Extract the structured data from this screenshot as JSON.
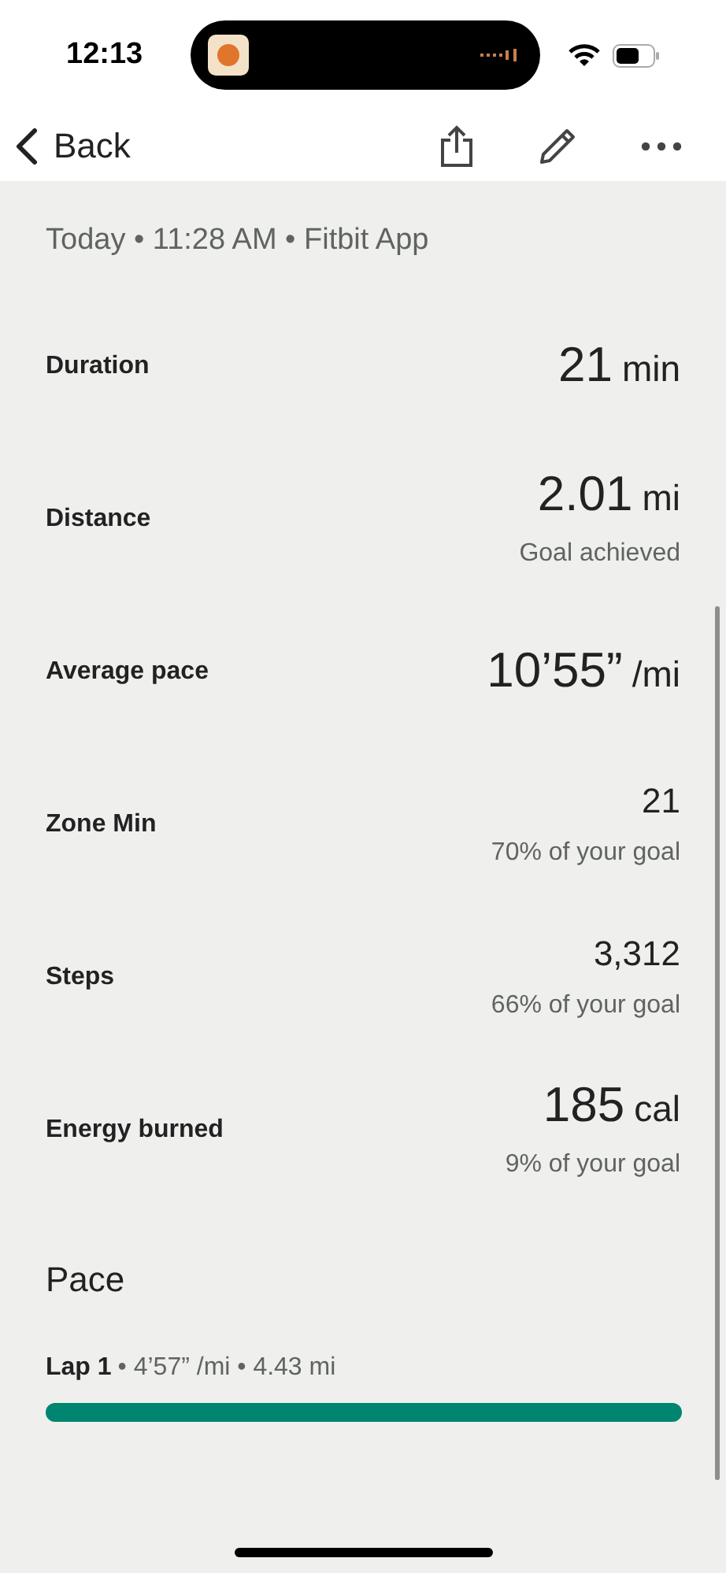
{
  "status_bar": {
    "time": "12:13"
  },
  "nav": {
    "back": "Back"
  },
  "subtitle": "Today • 11:28 AM • Fitbit App",
  "stats": [
    {
      "kind": "large",
      "label": "Duration",
      "value": "21",
      "unit": "min"
    },
    {
      "kind": "large",
      "label": "Distance",
      "value": "2.01",
      "unit": "mi",
      "note": "Goal achieved"
    },
    {
      "kind": "large",
      "label": "Average pace",
      "value": "10’55”",
      "unit": "/mi"
    },
    {
      "kind": "compact",
      "label": "Zone Min",
      "value": "21",
      "note": "70% of your goal"
    },
    {
      "kind": "compact",
      "label": "Steps",
      "value": "3,312",
      "note": "66% of your goal"
    },
    {
      "kind": "large",
      "label": "Energy burned",
      "value": "185",
      "unit": "cal",
      "note": "9% of your goal"
    }
  ],
  "pace": {
    "title": "Pace",
    "laps": [
      {
        "label": "Lap 1",
        "detail": "• 4’57” /mi • 4.43 mi",
        "level": 1
      }
    ]
  }
}
